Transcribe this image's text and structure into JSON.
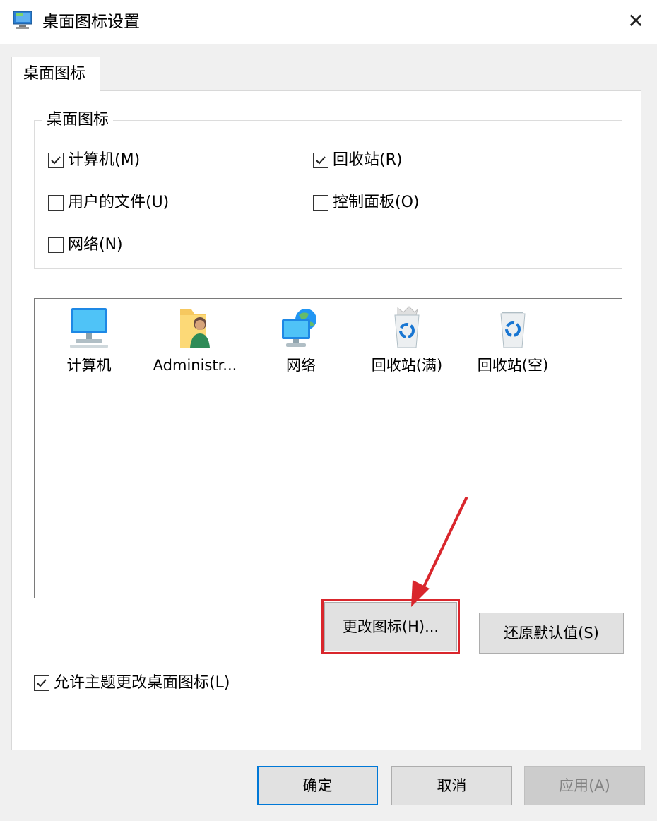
{
  "window": {
    "title": "桌面图标设置",
    "title_icon": "desktop-settings-icon",
    "close_glyph": "✕"
  },
  "tabs": [
    {
      "label": "桌面图标",
      "selected": true
    }
  ],
  "group": {
    "title": "桌面图标",
    "checkboxes": [
      {
        "label": "计算机(M)",
        "checked": true
      },
      {
        "label": "回收站(R)",
        "checked": true
      },
      {
        "label": "用户的文件(U)",
        "checked": false
      },
      {
        "label": "控制面板(O)",
        "checked": false
      },
      {
        "label": "网络(N)",
        "checked": false
      }
    ]
  },
  "icons": [
    {
      "label": "计算机",
      "icon": "computer-monitor-icon"
    },
    {
      "label": "Administr...",
      "icon": "user-folder-icon"
    },
    {
      "label": "网络",
      "icon": "network-globe-icon"
    },
    {
      "label": "回收站(满)",
      "icon": "recycle-bin-full-icon"
    },
    {
      "label": "回收站(空)",
      "icon": "recycle-bin-empty-icon"
    }
  ],
  "buttons": {
    "change_icon": "更改图标(H)...",
    "restore_default": "还原默认值(S)",
    "ok": "确定",
    "cancel": "取消",
    "apply": "应用(A)"
  },
  "theme_checkbox": {
    "label": "允许主题更改桌面图标(L)",
    "checked": true
  },
  "annotation": {
    "color": "#d9262c"
  }
}
